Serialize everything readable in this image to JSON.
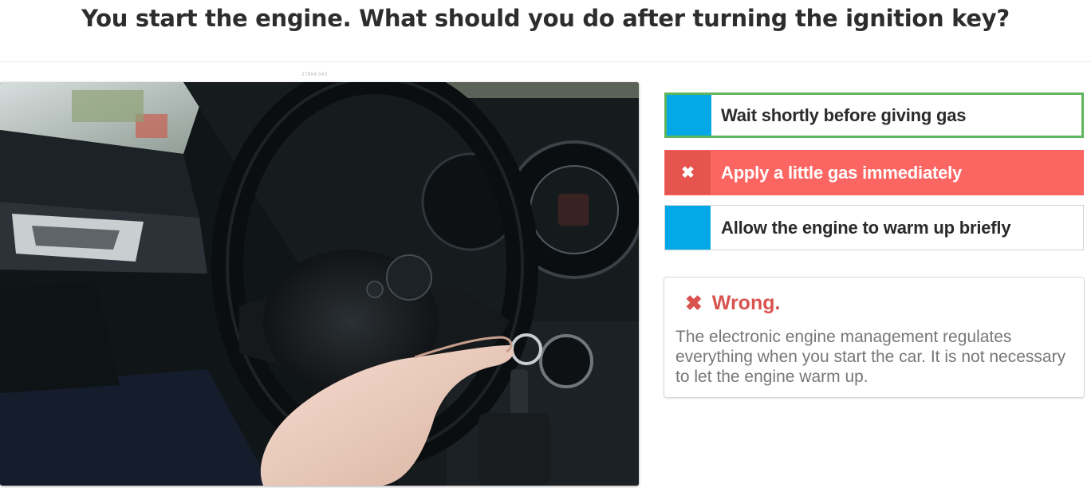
{
  "question": {
    "text": "You start the engine. What should you do after turning the ignition key?",
    "image_id": "27904 043"
  },
  "answers": [
    {
      "label": "Wait shortly before giving gas",
      "state": "correct"
    },
    {
      "label": "Apply a little gas immediately",
      "state": "selected-wrong",
      "icon": "x-icon"
    },
    {
      "label": "Allow the engine to warm up briefly",
      "state": "neutral"
    }
  ],
  "feedback": {
    "title": "Wrong.",
    "icon": "x-icon",
    "text": "The electronic engine management regulates everything when you start the car. It is not necessary to let the engine warm up."
  },
  "colors": {
    "tab_blue": "#04a8e6",
    "correct_border": "#5fb55d",
    "wrong_fill": "#fc6662",
    "wrong_text": "#d9534f"
  }
}
